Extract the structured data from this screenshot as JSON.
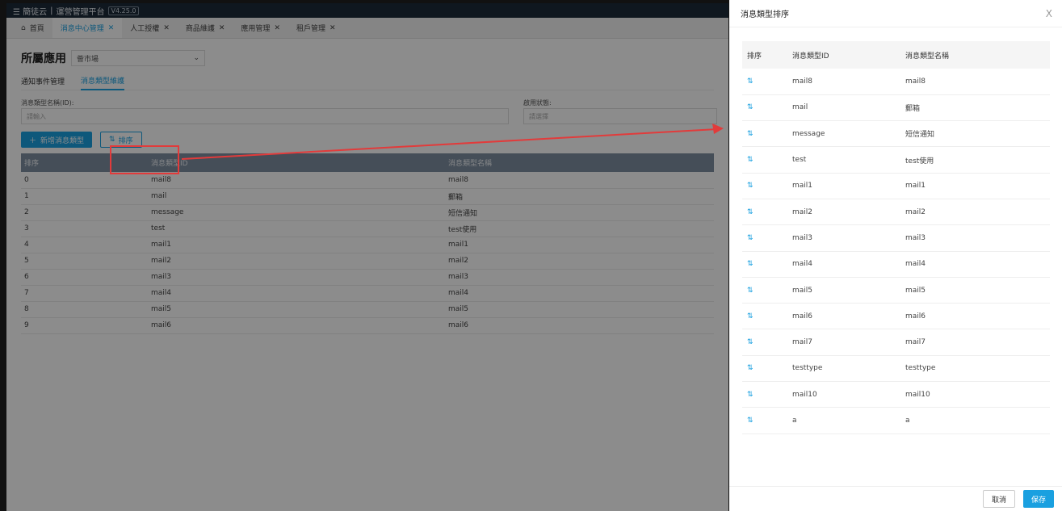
{
  "topbar": {
    "brand": "☰ 簡徒云",
    "divider": "|",
    "platform": "運營管理平台",
    "version": "V4.25.0"
  },
  "tabs": [
    {
      "label": "首頁",
      "active": false,
      "closable": false
    },
    {
      "label": "消息中心管理",
      "active": true,
      "closable": true
    },
    {
      "label": "人工授權",
      "active": false,
      "closable": true
    },
    {
      "label": "商品維護",
      "active": false,
      "closable": true
    },
    {
      "label": "應用管理",
      "active": false,
      "closable": true
    },
    {
      "label": "租戶管理",
      "active": false,
      "closable": true
    }
  ],
  "main": {
    "app_label": "所屬應用",
    "app_value": "薈市場",
    "subtabs": [
      {
        "label": "通知事件管理",
        "active": false
      },
      {
        "label": "消息類型維護",
        "active": true
      }
    ],
    "filter": {
      "name_label": "消息類型名稱(ID):",
      "name_placeholder": "請輸入",
      "status_label": "啟用狀態:",
      "status_placeholder": "請選擇"
    },
    "add_button": "新增消息類型",
    "sort_button": "排序",
    "columns": [
      "排序",
      "消息類型ID",
      "消息類型名稱"
    ],
    "rows": [
      [
        "0",
        "mail8",
        "mail8"
      ],
      [
        "1",
        "mail",
        "郵箱"
      ],
      [
        "2",
        "message",
        "短信通知"
      ],
      [
        "3",
        "test",
        "test使用"
      ],
      [
        "4",
        "mail1",
        "mail1"
      ],
      [
        "5",
        "mail2",
        "mail2"
      ],
      [
        "6",
        "mail3",
        "mail3"
      ],
      [
        "7",
        "mail4",
        "mail4"
      ],
      [
        "8",
        "mail5",
        "mail5"
      ],
      [
        "9",
        "mail6",
        "mail6"
      ]
    ]
  },
  "drawer": {
    "title": "消息類型排序",
    "close": "X",
    "columns": [
      "排序",
      "消息類型ID",
      "消息類型名稱"
    ],
    "rows": [
      [
        "mail8",
        "mail8"
      ],
      [
        "mail",
        "郵箱"
      ],
      [
        "message",
        "短信通知"
      ],
      [
        "test",
        "test使用"
      ],
      [
        "mail1",
        "mail1"
      ],
      [
        "mail2",
        "mail2"
      ],
      [
        "mail3",
        "mail3"
      ],
      [
        "mail4",
        "mail4"
      ],
      [
        "mail5",
        "mail5"
      ],
      [
        "mail6",
        "mail6"
      ],
      [
        "mail7",
        "mail7"
      ],
      [
        "testtype",
        "testtype"
      ],
      [
        "mail10",
        "mail10"
      ],
      [
        "a",
        "a"
      ]
    ],
    "cancel": "取消",
    "save": "保存"
  },
  "colors": {
    "accent": "#1aa0e0",
    "annotation": "#e23b3b",
    "topbar": "#1c2a3a",
    "table_header": "#7f8fa0"
  },
  "icons": {
    "home": "home-icon",
    "drag": "drag-sort-icon",
    "plus": "plus-icon",
    "chevron": "chevron-down-icon"
  }
}
